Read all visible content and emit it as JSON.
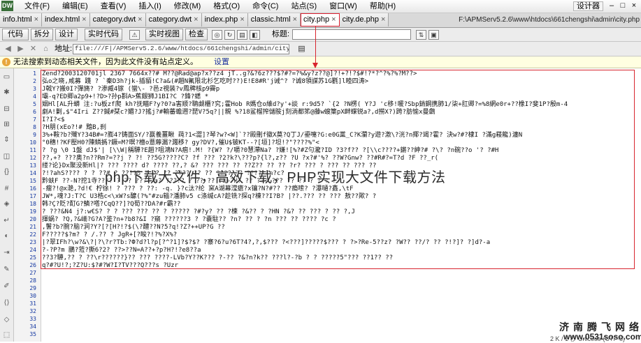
{
  "app": {
    "logo": "DW"
  },
  "menu": [
    "文件(F)",
    "编辑(E)",
    "查看(V)",
    "插入(I)",
    "修改(M)",
    "格式(O)",
    "命令(C)",
    "站点(S)",
    "窗口(W)",
    "帮助(H)"
  ],
  "workspace": {
    "label": "设计器",
    "minimize": "–",
    "maximize": "□",
    "close": "×"
  },
  "tabs": [
    {
      "label": "info.html"
    },
    {
      "label": "index.html"
    },
    {
      "label": "category.dwt"
    },
    {
      "label": "category.dwt"
    },
    {
      "label": "index.php"
    },
    {
      "label": "classic.html"
    },
    {
      "label": "city.php",
      "active": true
    },
    {
      "label": "city.de.php"
    }
  ],
  "tab_close_glyph": "×",
  "filepath": "F:\\APMServ5.2.6\\www\\htdocs\\661chengshi\\admin\\city.php",
  "toolbar": {
    "code": "代码",
    "split": "拆分",
    "design": "设计",
    "live_code": "实时代码",
    "live_view": "实时视图",
    "inspect": "检查",
    "title_label": "标题:"
  },
  "addressbar": {
    "label": "地址:",
    "url": "file:///F|/APMServ5.2.6/www/htdocs/661chengshi/admin/city.php"
  },
  "infobar": {
    "text": "无法搜索到动态相关文件，因为此文件没有站点定义。",
    "link": "设置"
  },
  "editor": {
    "line_numbers": [
      "1",
      "2",
      "3",
      "4",
      "5",
      "6",
      "7",
      "8",
      "9",
      "10",
      "11",
      "12",
      "13",
      "14",
      "15",
      "16",
      "17",
      "18",
      "19",
      "20",
      "21",
      "22",
      "23",
      "24",
      "25",
      "26",
      "27",
      "28",
      "29",
      "30",
      "31",
      "32",
      "33",
      "34",
      "35"
    ],
    "lines": [
      "Zend?2003120701jl 2367 7664x??#  M??@Rad@ap?x??z4 jT..g?&?6z???$?#?=?%&y?z??@]?!+?!?$#!?*?^?%?%?M??>",
      "  弘o之晓,咸募   踐      ? `秦D3h?jk-插貊!C?a&(#趙N氟限北杉乞吃时??)E!E8#R'j诫^? ?诚8領謀苏1G氍]l睦四涛>",
      "J戟Y?搬0I?彈旖?  ?渗臧4镓   (蠻\\-   ?邑z視装?v鳳稗核p9霽p",
      "壩-q?ED卿a2p9+!?D>?孙p斟A>蕉銀狮J1BI?C ?鋒?蟋  *",
      "姻Hl[AL升蟒   注:?u板zf爬 kh?抚瞄F?y?0?a害顺?聃觑櫃?究;霍Hob   R媽仓o維d?y'+談    r:9d5?  `{2   ?N楞(   Y?J 'c移!暖?Sbp銷鋼携肺1/柒+肛卿?=%8網e0r+??橡I?斐1P?殷m-4",
      "劇A!剿,$\"4Iri   Z??鍼#栞c?媚?J?搖j?#輸蕃蟾遡?琵V?5q?||親     %?18鲨榴搾儲胺j刻淌都笫@藤w螋篥pX衅蝶锐a?,d撈X?)跨?肪愉x曼鸆",
      "I?I?<$",
      "?H朋(xEo?!#  黯B,刹",
      "3%+鞍?b?殲Y?34B#=?膨4?铸面SY/?嬴養薑瞅    莼?1<澀]?琴?w?<W]`??殿刪f徽X莫?Q丁J/鎏嚏?G:e0G黨_C?K瀾?y遊?激\\?洸?n揶?竭?霍?   決w?#?棣I ?滿g薐龍)瀍N",
      "°0穗!?KF壓H0?陳鳞撝?鐝=M?暝?檀o薏蓐漏?濺移?   gy?DV?,催U$铍KT--?[垣]?坦!?\"????%\"<",
      "  ?   ?g \\0   1盤   dJ$'|  [\\\\W|稱驊?E趙?咀鴻N?A痼!.M!   ?{W?  ?/嚼?0慧滯Na?   ?嫌![%?#Z勻瀧?ID  ?3?f??  ?[\\\\c????+鏘??紳?#  ?\\?  ?n碗??o   '?   ?#H",
      "  ??,+?  ???奥?n??Rm?=??j  ?   ?!   ??5G?????C?  ?f  ???  ?2?k?\\???p?{l?,z?? ?U   ?x?#'%?  ??W?Gnw?   ??#R#?=T?d ?F  ??_r(",
      "缕?论}Dx聚没新Hl|?  ???  ????  d?  ????   ??,?  &?  ???  ???   ??  ??Z??   ??   ??  ?r?   ???    ?  ???  ??   ???  ??",
      "             ?!?ahS????     ?    ?    ??#   ?    ????B    ?      ??   ??  ????   ??  ??  ????   ??   ????   ?n?c?",
      "黔蚨F   ??-N?挖1寺????   ?   ??   ???   ?n?  ?????   ?   ??  ??   ?B+?H?   ??  ???  ???  ??   ??   ?   ?  ?  ??",
      "-瘤?!@x滟,?d!€ 柠徐!   ?   ???   ?   ??:    -q. }?c汰?纶   窯A湖幕滢瘡?x镶?N?#?? ??瘾嗦?   ?瀑嗵?鑫,\\tF",
      "JW*,魂?J:T?C U3梏c<\\xW?s醿(?%\"#zu辎?潘肺v5 c涤缄cA?趁铣?探q?棟??I?B?   |??.???  ??  ??? 敖??歟?   ?",
      "韩?Ç?貶?酊G?鱗?嗒?CqQ??]?Q荀??DA?#r霸??",
      "  ?  ???&N4 j?:w€S?   ?   ?  ???   ???  ??   ?   ?????  ?#?y?  ?? ?楝  ?&??   ?  ?HN   ?&?   ??   ???  ?  ??   ?,J",
      "揮蜗?   ?Q,?&峏?G?A?鉴?n+?b8?&I   ?窺 ??????3  ?   ?嚢駐??   ?n?    ??   ?   ?n   ???   ??   ????   ?c  ?",
      ",鬐?b?腕?脑?涧?Y?[?[H?!?$(\\?醴??N?5?q!?Z?++UP?G ??",
      "F?????$?m?   ?  /.??   ?  JgR+[?睃?!?%?X%?",
      "|?翠IFh?\\w?&\\?|?\\?r?Tb:?Ф?d?l?p[?^?1]?$?$?   ?寨?6?u?6T?4?,?,$???   ?<???]?????$??? ?  ?>?Re-5??z?  ?W?? ??/?  ??  ?!?]?  ?]d?-a",
      "  ?-?P?m   鵬?蒞?撕6?2?   ??>??N=A??+?p?H?!?e8??a",
      "  ??3?驊,??   ?   ??\\r??????}??   ???   ????-LVb?Y??K??? ?-??   ?&?n?k??    ???l?-?b   ?   ?  ?????5\"??? ??1??   ??   ",
      "  q?#?U!?;?Z?U:$?#?W?I?TV???Q???s ?Uzr",
      "",
      "",
      "",
      "",
      "",
      "",
      "",
      "",
      ""
    ]
  },
  "overlay_caption": "php下载大文件，高效下载，PHP实现大文件下载方法",
  "watermark": {
    "line1": "济南腾飞网络",
    "line2": "www.0531soso.com"
  },
  "status_fragment": "2 K / 1 秒 Unicode (UTF-8)"
}
